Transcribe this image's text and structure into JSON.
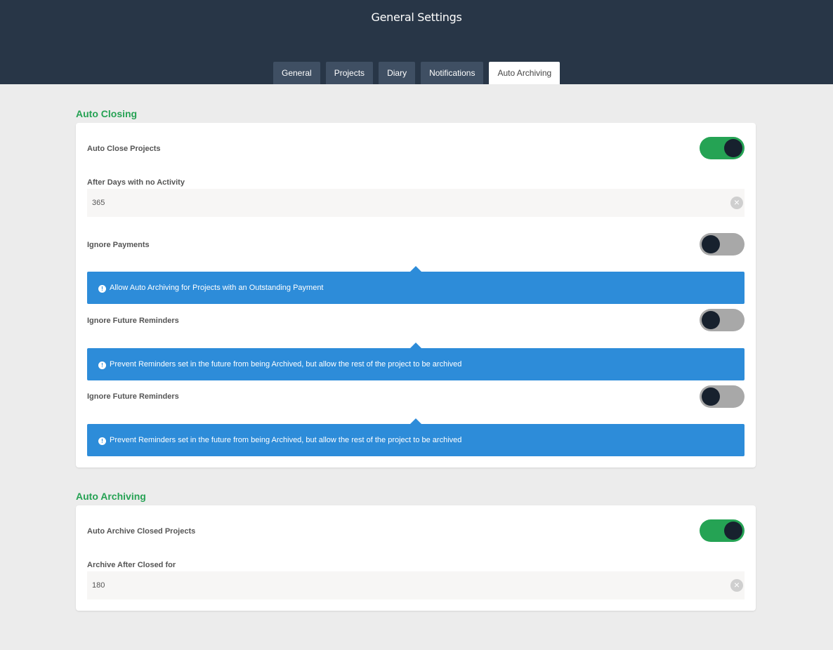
{
  "header": {
    "title": "General Settings",
    "tabs": [
      {
        "label": "General",
        "active": false
      },
      {
        "label": "Projects",
        "active": false
      },
      {
        "label": "Diary",
        "active": false
      },
      {
        "label": "Notifications",
        "active": false
      },
      {
        "label": "Auto Archiving",
        "active": true
      }
    ]
  },
  "auto_closing": {
    "title": "Auto Closing",
    "auto_close_projects": {
      "label": "Auto Close Projects",
      "enabled": true
    },
    "after_days": {
      "label": "After Days with no Activity",
      "value": "365"
    },
    "ignore_payments": {
      "label": "Ignore Payments",
      "enabled": false,
      "info": "Allow Auto Archiving for Projects with an Outstanding Payment"
    },
    "ignore_future_reminders_1": {
      "label": "Ignore Future Reminders",
      "enabled": false,
      "info": "Prevent Reminders set in the future from being Archived, but allow the rest of the project to be archived"
    },
    "ignore_future_reminders_2": {
      "label": "Ignore Future Reminders",
      "enabled": false,
      "info": "Prevent Reminders set in the future from being Archived, but allow the rest of the project to be archived"
    }
  },
  "auto_archiving": {
    "title": "Auto Archiving",
    "auto_archive_closed": {
      "label": "Auto Archive Closed Projects",
      "enabled": true
    },
    "archive_after": {
      "label": "Archive After Closed for",
      "value": "180"
    }
  },
  "icons": {
    "clear": "×",
    "info": "!"
  },
  "colors": {
    "header_bg": "#283647",
    "accent_green": "#25a354",
    "info_blue": "#2d8cd9"
  }
}
